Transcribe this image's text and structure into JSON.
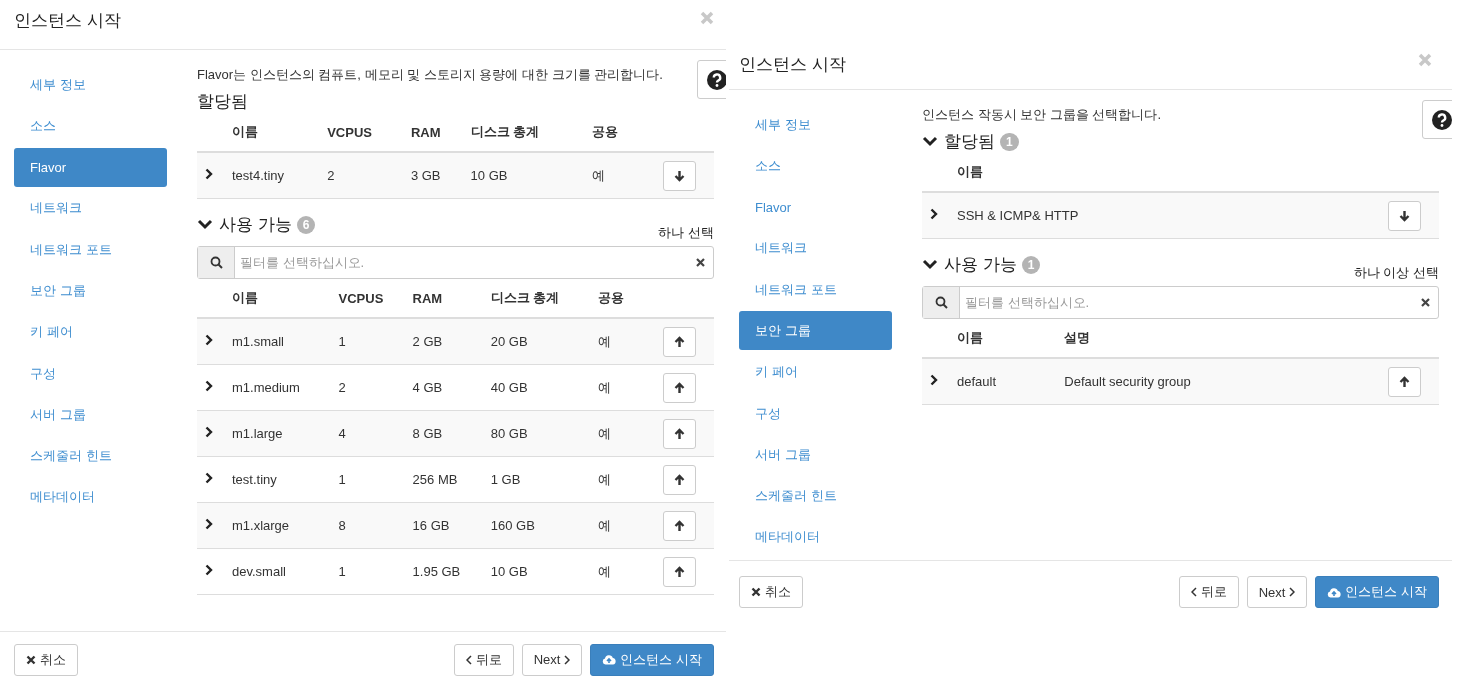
{
  "dialogs": [
    {
      "title": "인스턴스 시작",
      "steps": [
        {
          "label": "세부 정보",
          "selected": false
        },
        {
          "label": "소스",
          "selected": false
        },
        {
          "label": "Flavor",
          "selected": true
        },
        {
          "label": "네트워크",
          "selected": false
        },
        {
          "label": "네트워크 포트",
          "selected": false
        },
        {
          "label": "보안 그룹",
          "selected": false
        },
        {
          "label": "키 페어",
          "selected": false
        },
        {
          "label": "구성",
          "selected": false
        },
        {
          "label": "서버 그룹",
          "selected": false
        },
        {
          "label": "스케줄러 힌트",
          "selected": false
        },
        {
          "label": "메타데이터",
          "selected": false
        }
      ],
      "description": "Flavor는 인스턴스의 컴퓨트, 메모리 및 스토리지 용량에 대한 크기를 관리합니다.",
      "allocated": {
        "title": "할당됨",
        "kind": "remove",
        "columns": [
          "이름",
          "VCPUS",
          "RAM",
          "디스크 총계",
          "공용"
        ],
        "rows": [
          [
            "test4.tiny",
            "2",
            "3 GB",
            "10 GB",
            "예"
          ]
        ]
      },
      "available": {
        "title": "사용 가능",
        "expanded": true,
        "count": "6",
        "select_hint": "하나 선택",
        "filter_placeholder": "필터를 선택하십시오.",
        "kind": "add",
        "columns": [
          "이름",
          "VCPUS",
          "RAM",
          "디스크 총계",
          "공용"
        ],
        "rows": [
          [
            "m1.small",
            "1",
            "2 GB",
            "20 GB",
            "예"
          ],
          [
            "m1.medium",
            "2",
            "4 GB",
            "40 GB",
            "예"
          ],
          [
            "m1.large",
            "4",
            "8 GB",
            "80 GB",
            "예"
          ],
          [
            "test.tiny",
            "1",
            "256 MB",
            "1 GB",
            "예"
          ],
          [
            "m1.xlarge",
            "8",
            "16 GB",
            "160 GB",
            "예"
          ],
          [
            "dev.small",
            "1",
            "1.95 GB",
            "10 GB",
            "예"
          ]
        ]
      },
      "buttons": {
        "cancel": "취소",
        "back": "뒤로",
        "next": "Next",
        "launch": "인스턴스 시작"
      }
    },
    {
      "title": "인스턴스 시작",
      "steps": [
        {
          "label": "세부 정보",
          "selected": false
        },
        {
          "label": "소스",
          "selected": false
        },
        {
          "label": "Flavor",
          "selected": false
        },
        {
          "label": "네트워크",
          "selected": false
        },
        {
          "label": "네트워크 포트",
          "selected": false
        },
        {
          "label": "보안 그룹",
          "selected": true
        },
        {
          "label": "키 페어",
          "selected": false
        },
        {
          "label": "구성",
          "selected": false
        },
        {
          "label": "서버 그룹",
          "selected": false
        },
        {
          "label": "스케줄러 힌트",
          "selected": false
        },
        {
          "label": "메타데이터",
          "selected": false
        }
      ],
      "description": "인스턴스 작동시 보안 그룹을 선택합니다.",
      "allocated": {
        "title": "할당됨",
        "expanded": true,
        "count": "1",
        "kind": "remove",
        "columns": [
          "이름"
        ],
        "rows": [
          [
            "SSH & ICMP& HTTP"
          ]
        ]
      },
      "available": {
        "title": "사용 가능",
        "expanded": true,
        "count": "1",
        "select_hint": "하나 이상 선택",
        "filter_placeholder": "필터를 선택하십시오.",
        "kind": "add",
        "columns": [
          "이름",
          "설명"
        ],
        "rows": [
          [
            "default",
            "Default security group"
          ]
        ]
      },
      "buttons": {
        "cancel": "취소",
        "back": "뒤로",
        "next": "Next",
        "launch": "인스턴스 시작"
      }
    }
  ]
}
